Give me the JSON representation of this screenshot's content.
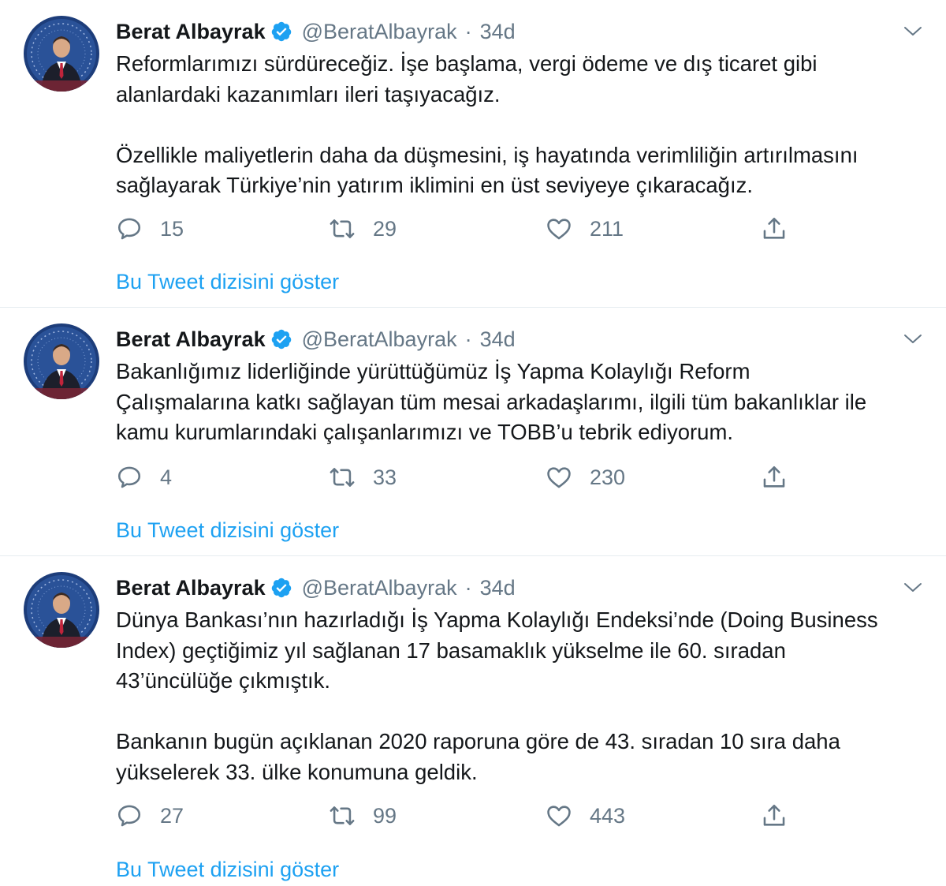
{
  "tweets": [
    {
      "name": "Berat Albayrak",
      "handle": "@BeratAlbayrak",
      "sep": "·",
      "time": "34d",
      "lines": [
        "Reformlarımızı sürdüreceğiz. İşe başlama, vergi ödeme ve dış ticaret gibi",
        "alanlardaki kazanımları ileri taşıyacağız.",
        "",
        "Özellikle maliyetlerin daha da düşmesini, iş hayatında verimliliğin artırılmasını",
        "sağlayarak Türkiye’nin yatırım iklimini en üst seviyeye çıkaracağız."
      ],
      "replies": "15",
      "retweets": "29",
      "likes": "211",
      "show_thread": "Bu Tweet dizisini göster"
    },
    {
      "name": "Berat Albayrak",
      "handle": "@BeratAlbayrak",
      "sep": "·",
      "time": "34d",
      "lines": [
        "Bakanlığımız liderliğinde yürüttüğümüz İş Yapma Kolaylığı Reform",
        "Çalışmalarına katkı sağlayan tüm mesai arkadaşlarımı, ilgili tüm bakanlıklar ile",
        "kamu kurumlarındaki çalışanlarımızı ve TOBB’u tebrik ediyorum."
      ],
      "replies": "4",
      "retweets": "33",
      "likes": "230",
      "show_thread": "Bu Tweet dizisini göster"
    },
    {
      "name": "Berat Albayrak",
      "handle": "@BeratAlbayrak",
      "sep": "·",
      "time": "34d",
      "lines": [
        "Dünya Bankası’nın hazırladığı İş Yapma Kolaylığı Endeksi’nde (Doing Business",
        "Index) geçtiğimiz yıl sağlanan 17 basamaklık yükselme ile 60. sıradan",
        "43’üncülüğe çıkmıştık.",
        "",
        "Bankanın bugün açıklanan 2020 raporuna göre de 43. sıradan 10 sıra daha",
        "yükselerek 33. ülke konumuna geldik."
      ],
      "replies": "27",
      "retweets": "99",
      "likes": "443",
      "show_thread": "Bu Tweet dizisini göster"
    }
  ],
  "icons": {
    "verified": "verified-badge-icon",
    "reply": "reply-icon",
    "retweet": "retweet-icon",
    "like": "heart-icon",
    "share": "share-icon",
    "caret": "chevron-down-icon"
  },
  "colors": {
    "link": "#1da1f2",
    "secondary": "#657786",
    "text": "#14171a",
    "divider": "#e6ecf0"
  }
}
